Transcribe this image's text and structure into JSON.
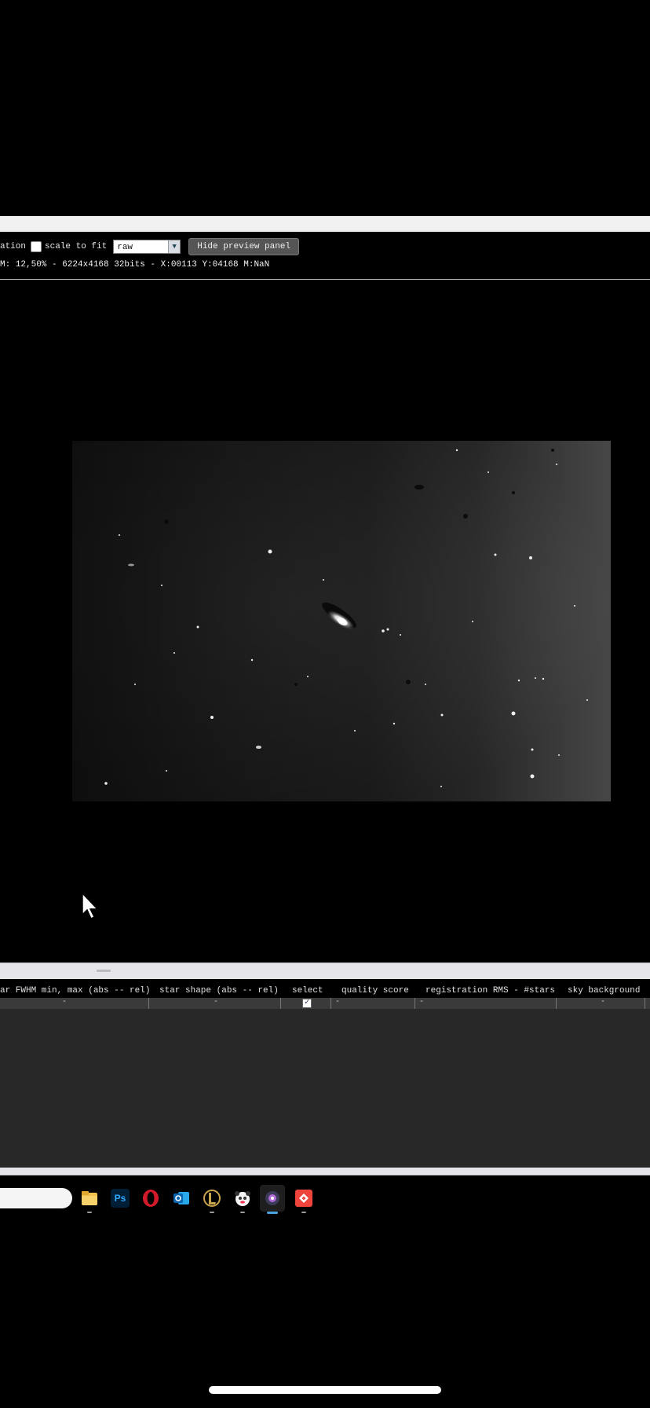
{
  "toolbar": {
    "left_truncated_label": "ation",
    "scale_to_fit_label": "scale to fit",
    "scale_to_fit_checked": false,
    "display_mode_value": "raw",
    "hide_preview_label": "Hide preview panel"
  },
  "status": {
    "text": "M: 12,50% - 6224x4168 32bits - X:00113 Y:04168 M:NaN"
  },
  "table": {
    "headers": [
      "ar FWHM min, max (abs -- rel)",
      "star shape (abs -- rel)",
      "select",
      "quality score",
      "registration RMS - #stars",
      "sky background"
    ],
    "row": {
      "fwhm": "-",
      "star_shape": "-",
      "selected": true,
      "quality": "-",
      "registration": "-",
      "sky": "-"
    }
  },
  "taskbar": {
    "icons": [
      "file-explorer-icon",
      "photoshop-icon",
      "opera-icon",
      "outlook-icon",
      "league-of-legends-icon",
      "panda-app-icon",
      "siril-icon",
      "anydesk-icon"
    ],
    "photoshop_label": "Ps"
  },
  "colors": {
    "background": "#000000",
    "panel_light": "#e6e6ea",
    "table_body": "#282828",
    "active_indicator": "#4aa3df"
  }
}
